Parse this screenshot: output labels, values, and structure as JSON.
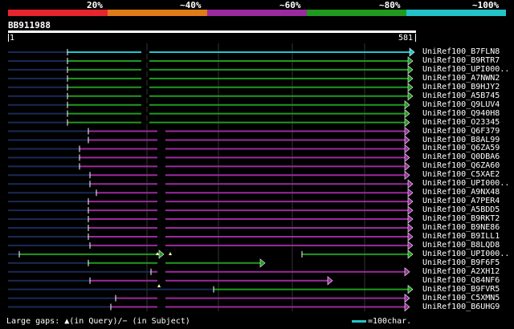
{
  "legend": {
    "segments": [
      {
        "label": "20%",
        "color": "#e8242e"
      },
      {
        "label": "~40%",
        "color": "#e07b1a"
      },
      {
        "label": "~60%",
        "color": "#9b2a9e"
      },
      {
        "label": "~80%",
        "color": "#1f9a1f"
      },
      {
        "label": "~100%",
        "color": "#22c4c8"
      }
    ]
  },
  "query": {
    "title": "BB911988",
    "start": "1",
    "end": "581"
  },
  "hits": [
    {
      "name": "UniRef100_B7FLN8",
      "color": "#22c4c8"
    },
    {
      "name": "UniRef100_B9RTR7",
      "color": "#1f9a1f"
    },
    {
      "name": "UniRef100_UPI000..",
      "color": "#1f9a1f"
    },
    {
      "name": "UniRef100_A7NWN2",
      "color": "#1f9a1f"
    },
    {
      "name": "UniRef100_B9HJY2",
      "color": "#1f9a1f"
    },
    {
      "name": "UniRef100_A5B745",
      "color": "#1f9a1f"
    },
    {
      "name": "UniRef100_Q9LUV4",
      "color": "#1f9a1f"
    },
    {
      "name": "UniRef100_Q940H8",
      "color": "#1f9a1f"
    },
    {
      "name": "UniRef100_O23345",
      "color": "#1f9a1f"
    },
    {
      "name": "UniRef100_Q6F379",
      "color": "#9b2a9e"
    },
    {
      "name": "UniRef100_B8AL99",
      "color": "#9b2a9e"
    },
    {
      "name": "UniRef100_Q6ZA59",
      "color": "#9b2a9e"
    },
    {
      "name": "UniRef100_Q0DBA6",
      "color": "#9b2a9e"
    },
    {
      "name": "UniRef100_Q6ZA60",
      "color": "#9b2a9e"
    },
    {
      "name": "UniRef100_C5XAE2",
      "color": "#9b2a9e"
    },
    {
      "name": "UniRef100_UPI000..",
      "color": "#9b2a9e"
    },
    {
      "name": "UniRef100_A9NX48",
      "color": "#9b2a9e"
    },
    {
      "name": "UniRef100_A7PER4",
      "color": "#9b2a9e"
    },
    {
      "name": "UniRef100_A5BDD5",
      "color": "#9b2a9e"
    },
    {
      "name": "UniRef100_B9RKT2",
      "color": "#9b2a9e"
    },
    {
      "name": "UniRef100_B9NE86",
      "color": "#9b2a9e"
    },
    {
      "name": "UniRef100_B9ILL1",
      "color": "#9b2a9e"
    },
    {
      "name": "UniRef100_B8LQD8",
      "color": "#9b2a9e"
    },
    {
      "name": "UniRef100_UPI000..",
      "color": "#1f9a1f"
    },
    {
      "name": "UniRef100_B9F6F5",
      "color": "#1f9a1f"
    },
    {
      "name": "UniRef100_A2XH12",
      "color": "#9b2a9e"
    },
    {
      "name": "UniRef100_Q84NF6",
      "color": "#9b2a9e"
    },
    {
      "name": "UniRef100_B9FVR5",
      "color": "#1f9a1f"
    },
    {
      "name": "UniRef100_C5XMN5",
      "color": "#9b2a9e"
    },
    {
      "name": "UniRef100_B6UHG9",
      "color": "#9b2a9e"
    }
  ],
  "footer": {
    "gaps_text": "Large gaps: ▲(in Query)/− (in Subject)",
    "key_text": "=100char."
  }
}
